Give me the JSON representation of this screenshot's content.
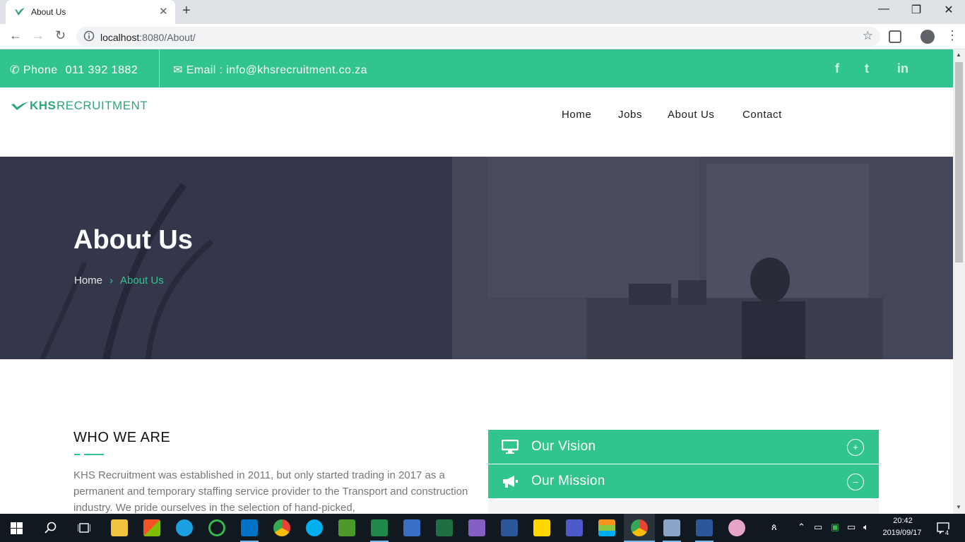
{
  "browser": {
    "tab_title": "About Us",
    "url_host": "localhost",
    "url_rest": ":8080/About/",
    "new_tab_label": "+",
    "close_tab_label": "✕"
  },
  "topbar": {
    "phone_label": "Phone",
    "phone_number": "011 392 1882",
    "email_label": "Email :",
    "email_value": "info@khsrecruitment.co.za",
    "social": [
      "f",
      "t",
      "in"
    ]
  },
  "brand": {
    "bold": "KHS",
    "light": "RECRUITMENT",
    "color": "#2aa876"
  },
  "nav": {
    "home": "Home",
    "jobs": "Jobs",
    "about": "About Us",
    "contact": "Contact"
  },
  "hero": {
    "title": "About Us",
    "breadcrumb_home": "Home",
    "breadcrumb_current": "About Us"
  },
  "who": {
    "heading": "WHO WE ARE",
    "text": "KHS Recruitment was established in 2011, but only started trading in 2017 as a permanent and temporary staffing service provider to the Transport and construction industry. We pride ourselves in the selection of hand-picked,"
  },
  "accordion": [
    {
      "label": "Our Vision",
      "toggle": "+",
      "icon": "monitor-icon"
    },
    {
      "label": "Our Mission",
      "toggle": "–",
      "icon": "megaphone-icon"
    }
  ],
  "taskbar": {
    "time": "20:42",
    "date": "2019/09/17",
    "notifications": "4"
  },
  "colors": {
    "accent": "#32c48e",
    "taskbar": "#101820"
  }
}
